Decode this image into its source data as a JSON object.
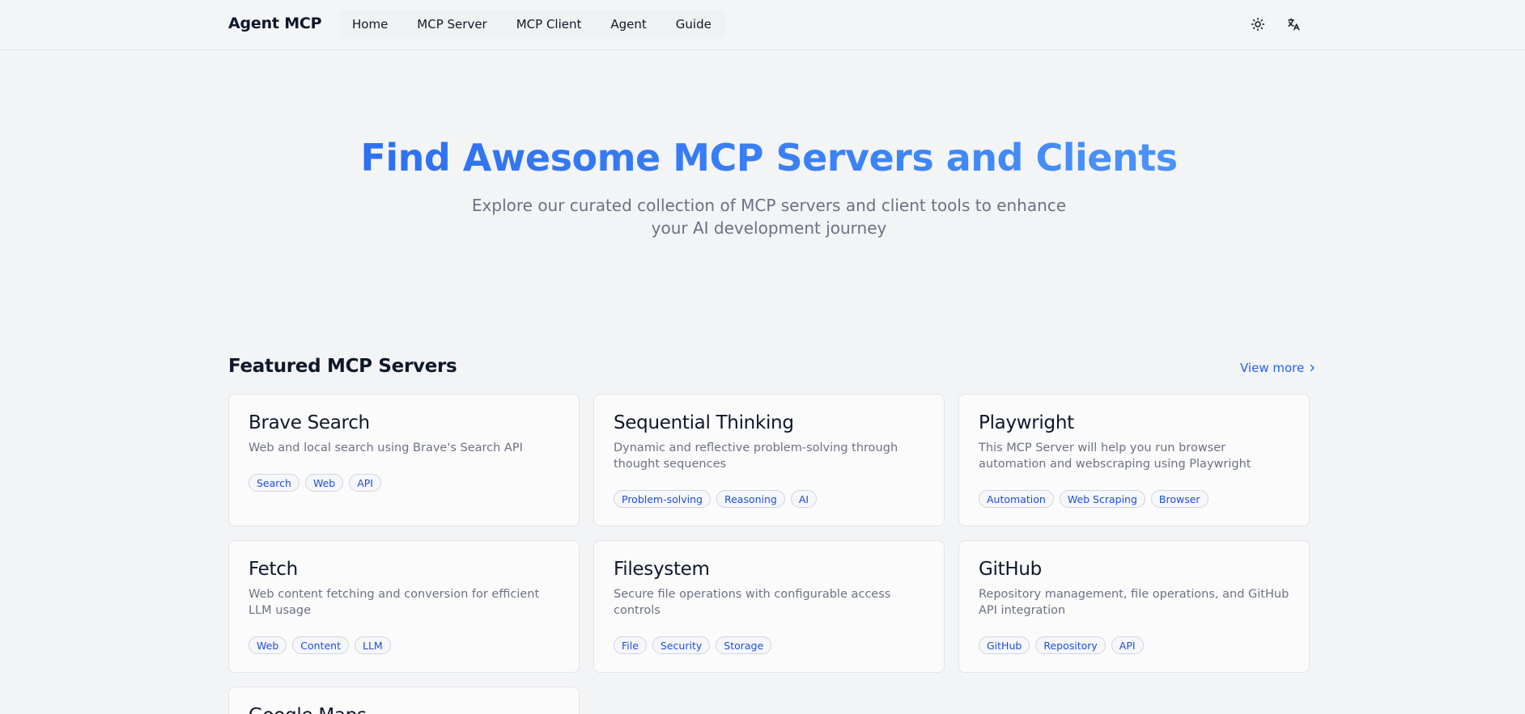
{
  "header": {
    "logo": "Agent MCP",
    "nav": [
      "Home",
      "MCP Server",
      "MCP Client",
      "Agent",
      "Guide"
    ],
    "theme_icon": "sun-icon",
    "language_icon": "translate-icon"
  },
  "hero": {
    "title": "Find Awesome MCP Servers and Clients",
    "subtitle": "Explore our curated collection of MCP servers and client tools to enhance your AI development journey"
  },
  "featured": {
    "title": "Featured MCP Servers",
    "view_more": "View more",
    "cards": [
      {
        "title": "Brave Search",
        "description": "Web and local search using Brave's Search API",
        "tags": [
          "Search",
          "Web",
          "API"
        ]
      },
      {
        "title": "Sequential Thinking",
        "description": "Dynamic and reflective problem-solving through thought sequences",
        "tags": [
          "Problem-solving",
          "Reasoning",
          "AI"
        ]
      },
      {
        "title": "Playwright",
        "description": "This MCP Server will help you run browser automation and webscraping using Playwright",
        "tags": [
          "Automation",
          "Web Scraping",
          "Browser"
        ]
      },
      {
        "title": "Fetch",
        "description": "Web content fetching and conversion for efficient LLM usage",
        "tags": [
          "Web",
          "Content",
          "LLM"
        ]
      },
      {
        "title": "Filesystem",
        "description": "Secure file operations with configurable access controls",
        "tags": [
          "File",
          "Security",
          "Storage"
        ]
      },
      {
        "title": "GitHub",
        "description": "Repository management, file operations, and GitHub API integration",
        "tags": [
          "GitHub",
          "Repository",
          "API"
        ]
      },
      {
        "title": "Google Maps",
        "description": "",
        "tags": []
      }
    ]
  },
  "colors": {
    "accent": "#2563eb",
    "background": "#f3f4f6",
    "card_background": "#fbfbfc"
  }
}
